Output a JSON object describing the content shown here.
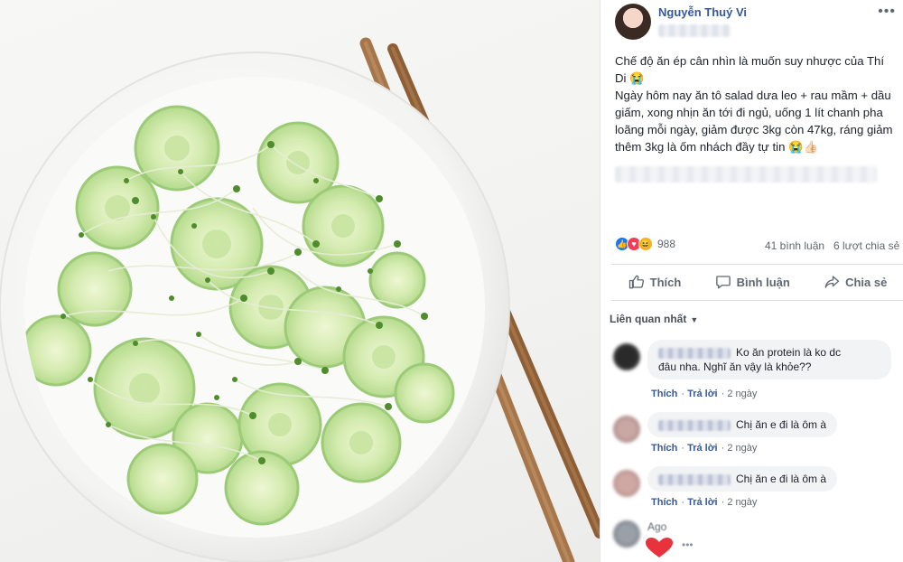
{
  "post": {
    "author": "Nguyễn Thuý Vi",
    "text_lines": [
      "Chế độ ăn ép cân nhìn là muốn suy nhược của Thí",
      "Di 😭",
      "Ngày hôm nay ăn tô salad dưa leo + rau mầm + dầu",
      "giấm, xong nhịn ăn tới đi ngủ, uống 1 lít chanh pha",
      "loãng mỗi ngày, giảm được 3kg còn 47kg, ráng giảm",
      "thêm 3kg là ốm nhách đầy tự tin 😭👍🏻"
    ],
    "reaction_count": "988",
    "comments_count": "41 bình luận",
    "shares_count": "6 lượt chia sẻ"
  },
  "actions": {
    "like": "Thích",
    "comment": "Bình luận",
    "share": "Chia sẻ"
  },
  "comments_section": {
    "sort_label": "Liên quan nhất",
    "comments": [
      {
        "text_line1": "Ko ăn protein là ko dc",
        "text_line2": "đâu nha. Nghĩ ăn vậy là khỏe??",
        "like": "Thích",
        "reply": "Trả lời",
        "time": "2 ngày"
      },
      {
        "text": "Chị ăn e đi là ôm à",
        "like": "Thích",
        "reply": "Trả lời",
        "time": "2 ngày"
      },
      {
        "text": "Chị ăn e đi là ôm à",
        "like": "Thích",
        "reply": "Trả lời",
        "time": "2 ngày"
      }
    ],
    "last_fragment": "Ago",
    "more": "•••"
  },
  "colors": {
    "name_blue": "#365899",
    "accent_blue": "#1877f2",
    "love_red": "#f33e58",
    "muted": "#606770",
    "bubble": "#f2f3f5"
  },
  "icons": {
    "like": "thumbs-up-icon",
    "comment": "speech-bubble-icon",
    "share": "share-arrow-icon",
    "more": "more-horizontal-icon",
    "heart": "heart-reaction-icon"
  }
}
